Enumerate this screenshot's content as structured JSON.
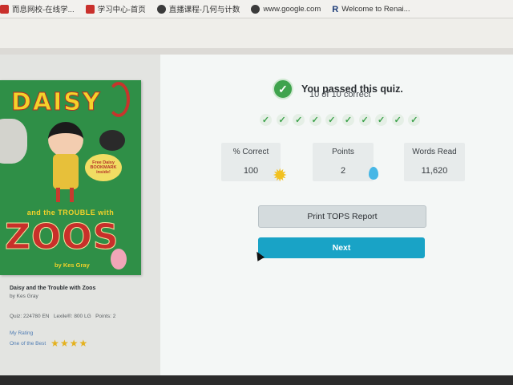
{
  "bookmarks": [
    {
      "label": "而息网校-在线学...",
      "icon": "school-icon"
    },
    {
      "label": "学习中心-首页",
      "icon": "bookmark-red-icon"
    },
    {
      "label": "直播课程-几何与计数",
      "icon": "globe-icon"
    },
    {
      "label": "www.google.com",
      "icon": "globe-icon"
    },
    {
      "label": "Welcome to Renai...",
      "icon": "renaissance-r-icon"
    }
  ],
  "book": {
    "cover_title": "DAISY",
    "cover_subtitle": "and the TROUBLE with",
    "cover_title2": "ZOOS",
    "cover_author": "by Kes Gray",
    "cover_badge": "Free Daisy BOOKMARK inside!",
    "title": "Daisy and the Trouble with Zoos",
    "author": "by Kes Gray",
    "quiz": "Quiz: 224780 EN",
    "lexile": "Lexile®: 800 LG",
    "points": "Points: 2",
    "my_rating_label": "My Rating",
    "rating_text": "One of the Best",
    "rating_stars": 4
  },
  "result": {
    "passed_text": "You passed this quiz.",
    "correct_text": "10 of 10 correct",
    "question_checks": 10
  },
  "stats": {
    "percent_label": "% Correct",
    "percent_value": "100",
    "points_label": "Points",
    "points_value": "2",
    "words_label": "Words Read",
    "words_value": "11,620"
  },
  "buttons": {
    "print": "Print TOPS Report",
    "next": "Next"
  },
  "colors": {
    "passed_green": "#3fa34d",
    "next_button": "#19a3c6",
    "star": "#e4b11e"
  }
}
